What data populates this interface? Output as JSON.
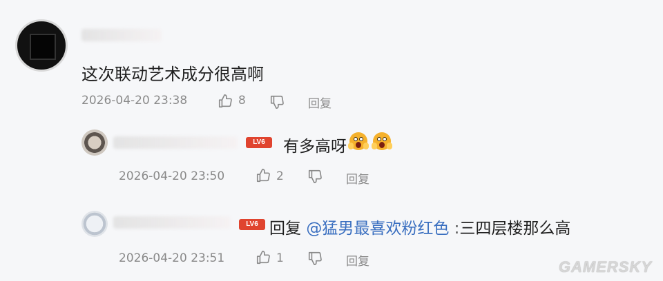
{
  "comment": {
    "text": "这次联动艺术成分很高啊",
    "timestamp": "2026-04-20 23:38",
    "likes": "8",
    "reply_label": "回复"
  },
  "replies": [
    {
      "badge": "LV6",
      "text": "有多高呀",
      "timestamp": "2026-04-20 23:50",
      "likes": "2",
      "reply_label": "回复"
    },
    {
      "badge": "LV6",
      "prefix": "回复",
      "mention": "@猛男最喜欢粉红色",
      "separator": ":",
      "text": "三四层楼那么高",
      "timestamp": "2026-04-20 23:51",
      "likes": "1",
      "reply_label": "回复"
    }
  ],
  "watermark": "GAMERSKY",
  "colors": {
    "mention": "#3a6fc0",
    "badge": "#e0442f",
    "meta": "#8a8a8a"
  },
  "icons": [
    "thumbs-up-icon",
    "thumbs-down-icon",
    "surprised-emoji-icon"
  ]
}
